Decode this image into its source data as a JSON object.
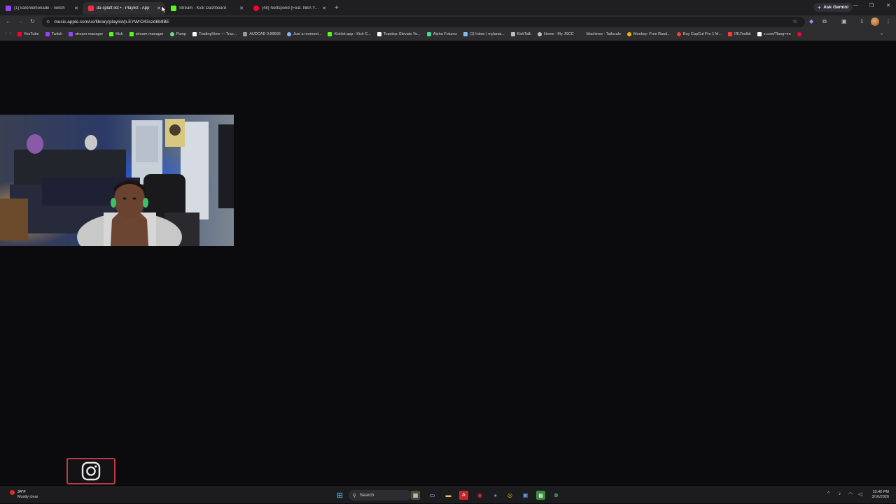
{
  "browser": {
    "tabs": [
      {
        "title": "(1) karenlemonade - Twitch",
        "favicon": "twitch-icon",
        "color": "#9146ff",
        "active": false
      },
      {
        "title": "da splatt list • - Playlist - App",
        "favicon": "apple-music-icon",
        "color": "#fa2d48",
        "active": true
      },
      {
        "title": "Stream - Kick Dashboard",
        "favicon": "kick-icon",
        "color": "#53fc18",
        "active": false
      },
      {
        "title": "(48) Nettspend (Feat. NBA Youn",
        "favicon": "youtube-icon",
        "color": "#ff0033",
        "active": false
      }
    ],
    "ask_label": "Ask Gemini",
    "url": "music.apple.com/us/library/playlist/p.EYWrO43szd8b9BE",
    "bookmarks": [
      {
        "label": "YouTube",
        "color": "#ff0033"
      },
      {
        "label": "Twitch",
        "color": "#9146ff"
      },
      {
        "label": "stream manager",
        "color": "#9146ff"
      },
      {
        "label": "Kick",
        "color": "#53fc18"
      },
      {
        "label": "stream manager",
        "color": "#53fc18"
      },
      {
        "label": "Pump",
        "color": "#6fdc8c"
      },
      {
        "label": "TradingView — Trac...",
        "color": "#ffffff"
      },
      {
        "label": "AUDCAD 0.89596",
        "color": "#9a9a9a"
      },
      {
        "label": "Just a moment...",
        "color": "#8ab4f8"
      },
      {
        "label": "Kicklet.app - Kick C...",
        "color": "#53fc18"
      },
      {
        "label": "Topstep: Elevate Yo...",
        "color": "#ffffff"
      },
      {
        "label": "Alpha Futures",
        "color": "#3ddc97"
      },
      {
        "label": "(1) Inbox | mylanai...",
        "color": "#8ab4f8"
      },
      {
        "label": "KickTalk",
        "color": "#bdbdbd"
      },
      {
        "label": "Home - My JSCC",
        "color": "#bdbdbd"
      },
      {
        "label": "Machines - Tailscale",
        "color": "#2e2e31"
      },
      {
        "label": "Monkey: Free Rand...",
        "color": "#f4b400"
      },
      {
        "label": "Buy CapCut Pro 1 M...",
        "color": "#ea4335"
      },
      {
        "label": "IRLToolkit",
        "color": "#ff3b30"
      },
      {
        "label": "x.com/?lang=en",
        "color": "#ffffff"
      }
    ]
  },
  "taskbar": {
    "weather_temp": "34°F",
    "weather_desc": "Mostly clear",
    "search_placeholder": "Search",
    "time": "10:40 PM",
    "date": "3/16/2026"
  },
  "overlay": {
    "webcam": "webcam-feed",
    "social": "instagram-icon"
  }
}
